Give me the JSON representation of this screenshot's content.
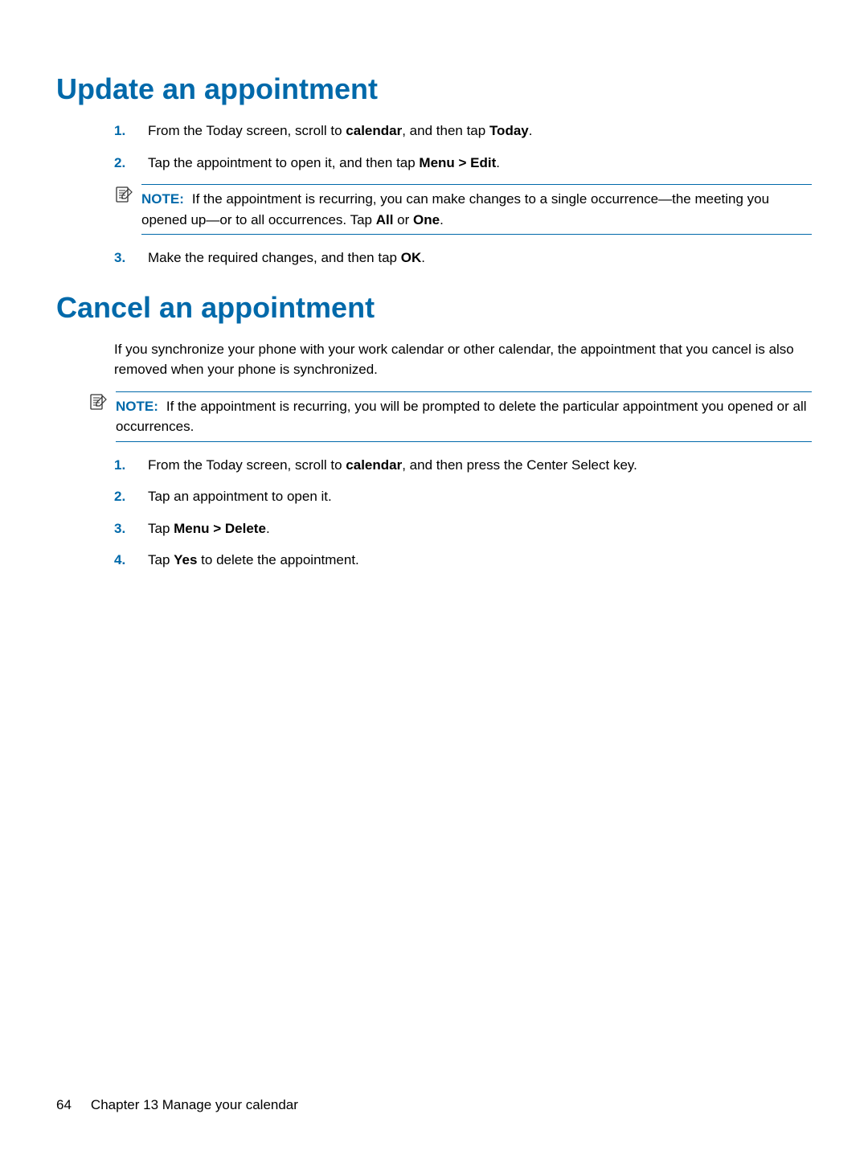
{
  "section1": {
    "heading": "Update an appointment",
    "steps": [
      {
        "num": "1.",
        "pre": "From the Today screen, scroll to ",
        "b1": "calendar",
        "mid": ", and then tap ",
        "b2": "Today",
        "post": "."
      },
      {
        "num": "2.",
        "pre": "Tap the appointment to open it, and then tap ",
        "b1": "Menu > Edit",
        "post": "."
      },
      {
        "num": "3.",
        "pre": "Make the required changes, and then tap ",
        "b1": "OK",
        "post": "."
      }
    ],
    "note": {
      "label": "NOTE:",
      "pre": "If the appointment is recurring, you can make changes to a single occurrence—the meeting you opened up—or to all occurrences. Tap ",
      "b1": "All",
      "mid": " or ",
      "b2": "One",
      "post": "."
    }
  },
  "section2": {
    "heading": "Cancel an appointment",
    "intro": "If you synchronize your phone with your work calendar or other calendar, the appointment that you cancel is also removed when your phone is synchronized.",
    "note": {
      "label": "NOTE:",
      "text": "If the appointment is recurring, you will be prompted to delete the particular appointment you opened or all occurrences."
    },
    "steps": [
      {
        "num": "1.",
        "pre": "From the Today screen, scroll to ",
        "b1": "calendar",
        "post": ", and then press the Center Select key."
      },
      {
        "num": "2.",
        "pre": "Tap an appointment to open it."
      },
      {
        "num": "3.",
        "pre": "Tap ",
        "b1": "Menu > Delete",
        "post": "."
      },
      {
        "num": "4.",
        "pre": "Tap ",
        "b1": "Yes",
        "post": " to delete the appointment."
      }
    ]
  },
  "footer": {
    "page": "64",
    "chapter": "Chapter 13   Manage your calendar"
  }
}
